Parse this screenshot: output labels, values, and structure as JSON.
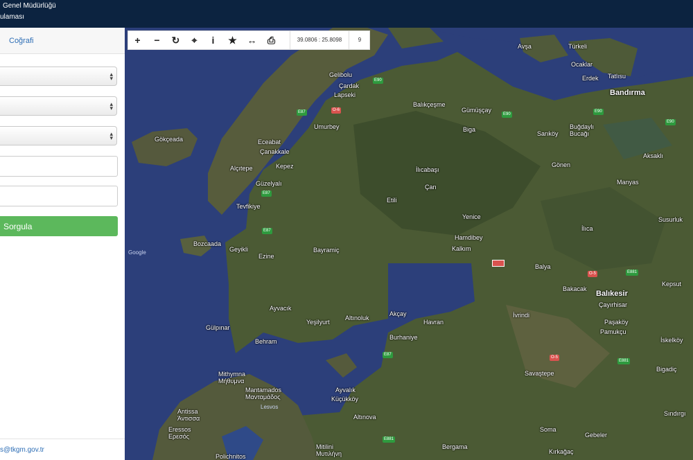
{
  "header": {
    "title_line1": "Genel Müdürlüğü",
    "title_line2": "ulaması"
  },
  "sidebar": {
    "tab_label": "Coğrafi",
    "submit_label": "Sorgula",
    "footer_email": "s@tkgm.gov.tr"
  },
  "toolbar": {
    "zoom_in": "+",
    "zoom_out": "−",
    "refresh": "↻",
    "locate": "⌖",
    "info": "i",
    "favorite": "★",
    "measure": "↔",
    "print": "⎙",
    "coordinates": "39.0806 : 25.8098",
    "zoom_level": "9"
  },
  "map": {
    "labels": [
      "Avşa",
      "Türkeli",
      "Ocaklar",
      "Erdek",
      "Tatlısu",
      "Bandırma",
      "Gelibolu",
      "Çardak",
      "Lapseki",
      "Balıkçeşme",
      "Gümüşçay",
      "Biga",
      "Sarıköy",
      "Buğdaylı Bucağı",
      "Gökçeada",
      "Eceabat",
      "Çanakkale",
      "Umurbey",
      "Kepez",
      "Alçıtepe",
      "Güzelyalı",
      "İlıcabaşı",
      "Gönen",
      "Aksaklı",
      "Çan",
      "Manyas",
      "Tevfikiye",
      "Etili",
      "Yenice",
      "Susurluk",
      "Bozcaada",
      "Geyikli",
      "Bayramiç",
      "Hamdibey",
      "Kalkım",
      "Ezine",
      "İlıca",
      "Balya",
      "Bakacak",
      "Balıkesir",
      "Kepsut",
      "Çayırhisar",
      "Ayvacık",
      "Yeşilyurt",
      "Altınoluk",
      "Akçay",
      "Havran",
      "Burhaniye",
      "İvrindi",
      "Paşaköy",
      "Pamukçu",
      "İskelköy",
      "Gülpınar",
      "Behram",
      "Mithymna Μήθυμνα",
      "Mantamados Μανταμάδος",
      "Lesvos",
      "Ayvalık",
      "Küçükköy",
      "Savaştepe",
      "Bigadiç",
      "Antissa Άντισσα",
      "Eressos Ερεσός",
      "Altınova",
      "Sındırgı",
      "Soma",
      "Gebeler",
      "Mitilini Μυτιλήνη",
      "Bergama",
      "Kırkağaç",
      "Polichnitos",
      "Google"
    ],
    "road_shields": [
      "E90",
      "E87",
      "O-6",
      "E90",
      "E90",
      "E90",
      "E87",
      "E87",
      "O-5",
      "E881",
      "O-5",
      "E881",
      "E87",
      "E881"
    ]
  },
  "colors": {
    "header_bg": "#0c2340",
    "submit_bg": "#5cb85c",
    "link": "#2c6db5",
    "sea": "#2c3f7a"
  }
}
